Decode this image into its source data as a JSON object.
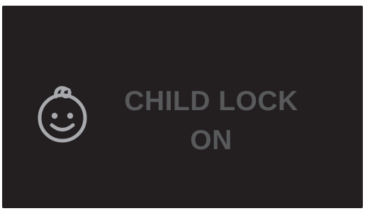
{
  "display": {
    "icon": "child-face-icon",
    "line1": "CHILD LOCK",
    "line2": "ON"
  },
  "colors": {
    "background": "#231f20",
    "text": "#58595b",
    "icon": "#a7a9ac"
  }
}
